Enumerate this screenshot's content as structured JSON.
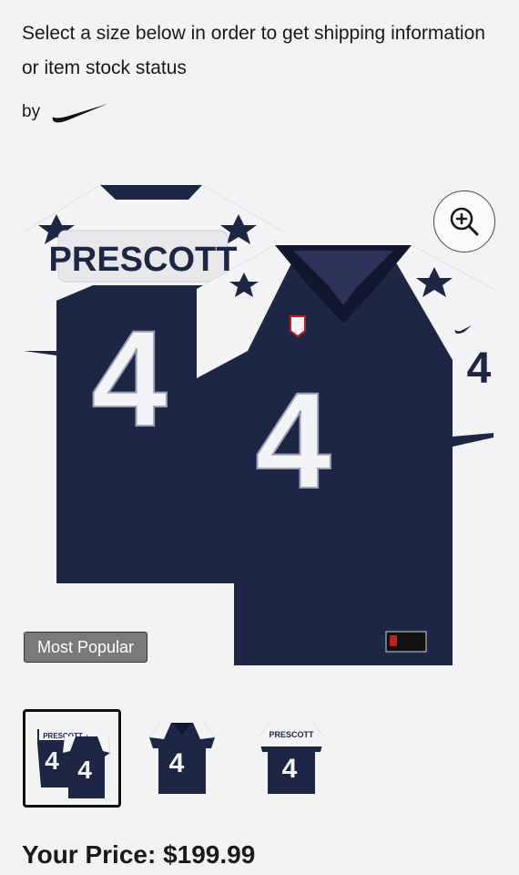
{
  "product": {
    "notice": "Select a size below in order to get shipping information or item stock status",
    "by_label": "by",
    "brand_icon": "nike-swoosh-icon",
    "image": {
      "player_name": "PRESCOTT",
      "number": "4",
      "colors": {
        "navy": "#1d2645",
        "white": "#f4f4f6",
        "star": "#1d2645"
      }
    },
    "zoom_icon": "zoom-in-icon",
    "badge": "Most Popular",
    "thumbnails": [
      {
        "view": "front-and-back",
        "selected": true,
        "name_text": "PRESCOTT",
        "number": "4"
      },
      {
        "view": "front",
        "selected": false,
        "number": "4"
      },
      {
        "view": "back",
        "selected": false,
        "name_text": "PRESCOTT",
        "number": "4"
      }
    ],
    "price_text": "Your Price: $199.99"
  }
}
